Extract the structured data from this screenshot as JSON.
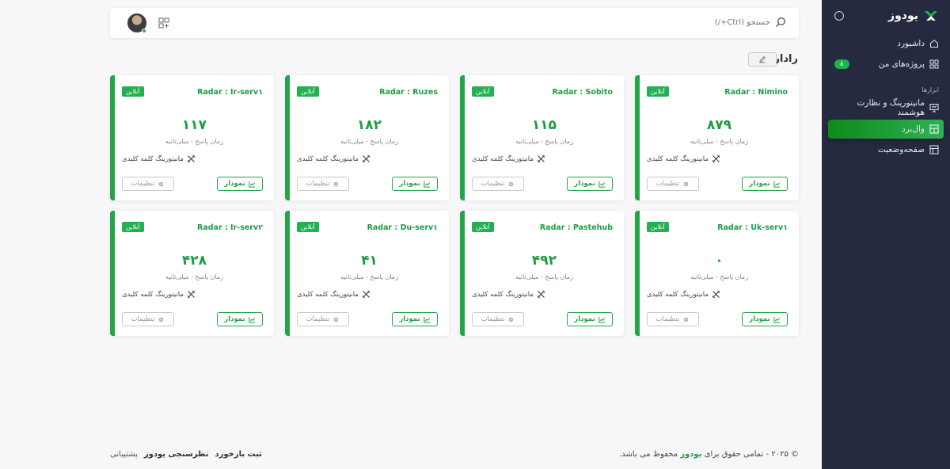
{
  "sidebar": {
    "brand": "یودوز",
    "section_label": "ابزارها",
    "items": [
      {
        "label": "داشبورد",
        "icon": "home-icon"
      },
      {
        "label": "پروژه‌های من",
        "icon": "grid-icon",
        "badge": "۸"
      },
      {
        "label": "مانیتورینگ و نظارت هوشمند",
        "icon": "monitor-icon"
      },
      {
        "label": "وال‌برد",
        "icon": "layout-icon",
        "active": true
      },
      {
        "label": "صفحه‌وضعیت",
        "icon": "status-page-icon"
      }
    ]
  },
  "header": {
    "search_placeholder": "جستجو (Ctrl+/)"
  },
  "page": {
    "title": "رادار"
  },
  "cards": [
    {
      "title": "Radar : Nimino",
      "badge": "آنلاین",
      "value": "۸۷۹",
      "subtitle": "زمان پاسخ - میلی‌ثانیه",
      "keyword": "مانیتورینگ کلمه کلیدی",
      "chart_label": "نمودار",
      "settings_label": "تنظیمات"
    },
    {
      "title": "Radar : Sobito",
      "badge": "آنلاین",
      "value": "۱۱۵",
      "subtitle": "زمان پاسخ - میلی‌ثانیه",
      "keyword": "مانیتورینگ کلمه کلیدی",
      "chart_label": "نمودار",
      "settings_label": "تنظیمات"
    },
    {
      "title": "Radar : Ruzes",
      "badge": "آنلاین",
      "value": "۱۸۲",
      "subtitle": "زمان پاسخ - میلی‌ثانیه",
      "keyword": "مانیتورینگ کلمه کلیدی",
      "chart_label": "نمودار",
      "settings_label": "تنظیمات"
    },
    {
      "title": "Radar : Ir-serv۱",
      "badge": "آنلاین",
      "value": "۱۱۷",
      "subtitle": "زمان پاسخ - میلی‌ثانیه",
      "keyword": "مانیتورینگ کلمه کلیدی",
      "chart_label": "نمودار",
      "settings_label": "تنظیمات"
    },
    {
      "title": "Radar : Uk-serv۱",
      "badge": "آنلاین",
      "value": "۰",
      "subtitle": "زمان پاسخ - میلی‌ثانیه",
      "keyword": "مانیتورینگ کلمه کلیدی",
      "chart_label": "نمودار",
      "settings_label": "تنظیمات"
    },
    {
      "title": "Radar : Pastehub",
      "badge": "آنلاین",
      "value": "۴۹۲",
      "subtitle": "زمان پاسخ - میلی‌ثانیه",
      "keyword": "مانیتورینگ کلمه کلیدی",
      "chart_label": "نمودار",
      "settings_label": "تنظیمات"
    },
    {
      "title": "Radar : Du-serv۱",
      "badge": "آنلاین",
      "value": "۴۱",
      "subtitle": "زمان پاسخ - میلی‌ثانیه",
      "keyword": "مانیتورینگ کلمه کلیدی",
      "chart_label": "نمودار",
      "settings_label": "تنظیمات"
    },
    {
      "title": "Radar : Ir-serv۲",
      "badge": "آنلاین",
      "value": "۴۲۸",
      "subtitle": "زمان پاسخ - میلی‌ثانیه",
      "keyword": "مانیتورینگ کلمه کلیدی",
      "chart_label": "نمودار",
      "settings_label": "تنظیمات"
    }
  ],
  "footer": {
    "copyright_prefix": "© ۲۰۲۵ - تمامی حقوق برای",
    "copyright_brand": "یودوز",
    "copyright_suffix": "محفوظ می باشد.",
    "links": [
      "ثبت بازخورد",
      "نظرسنجی یودوز",
      "پشتیبانی"
    ]
  },
  "colors": {
    "accent": "#22a447",
    "sidebar_bg": "#252a40",
    "page_bg": "#f7f7f9"
  }
}
